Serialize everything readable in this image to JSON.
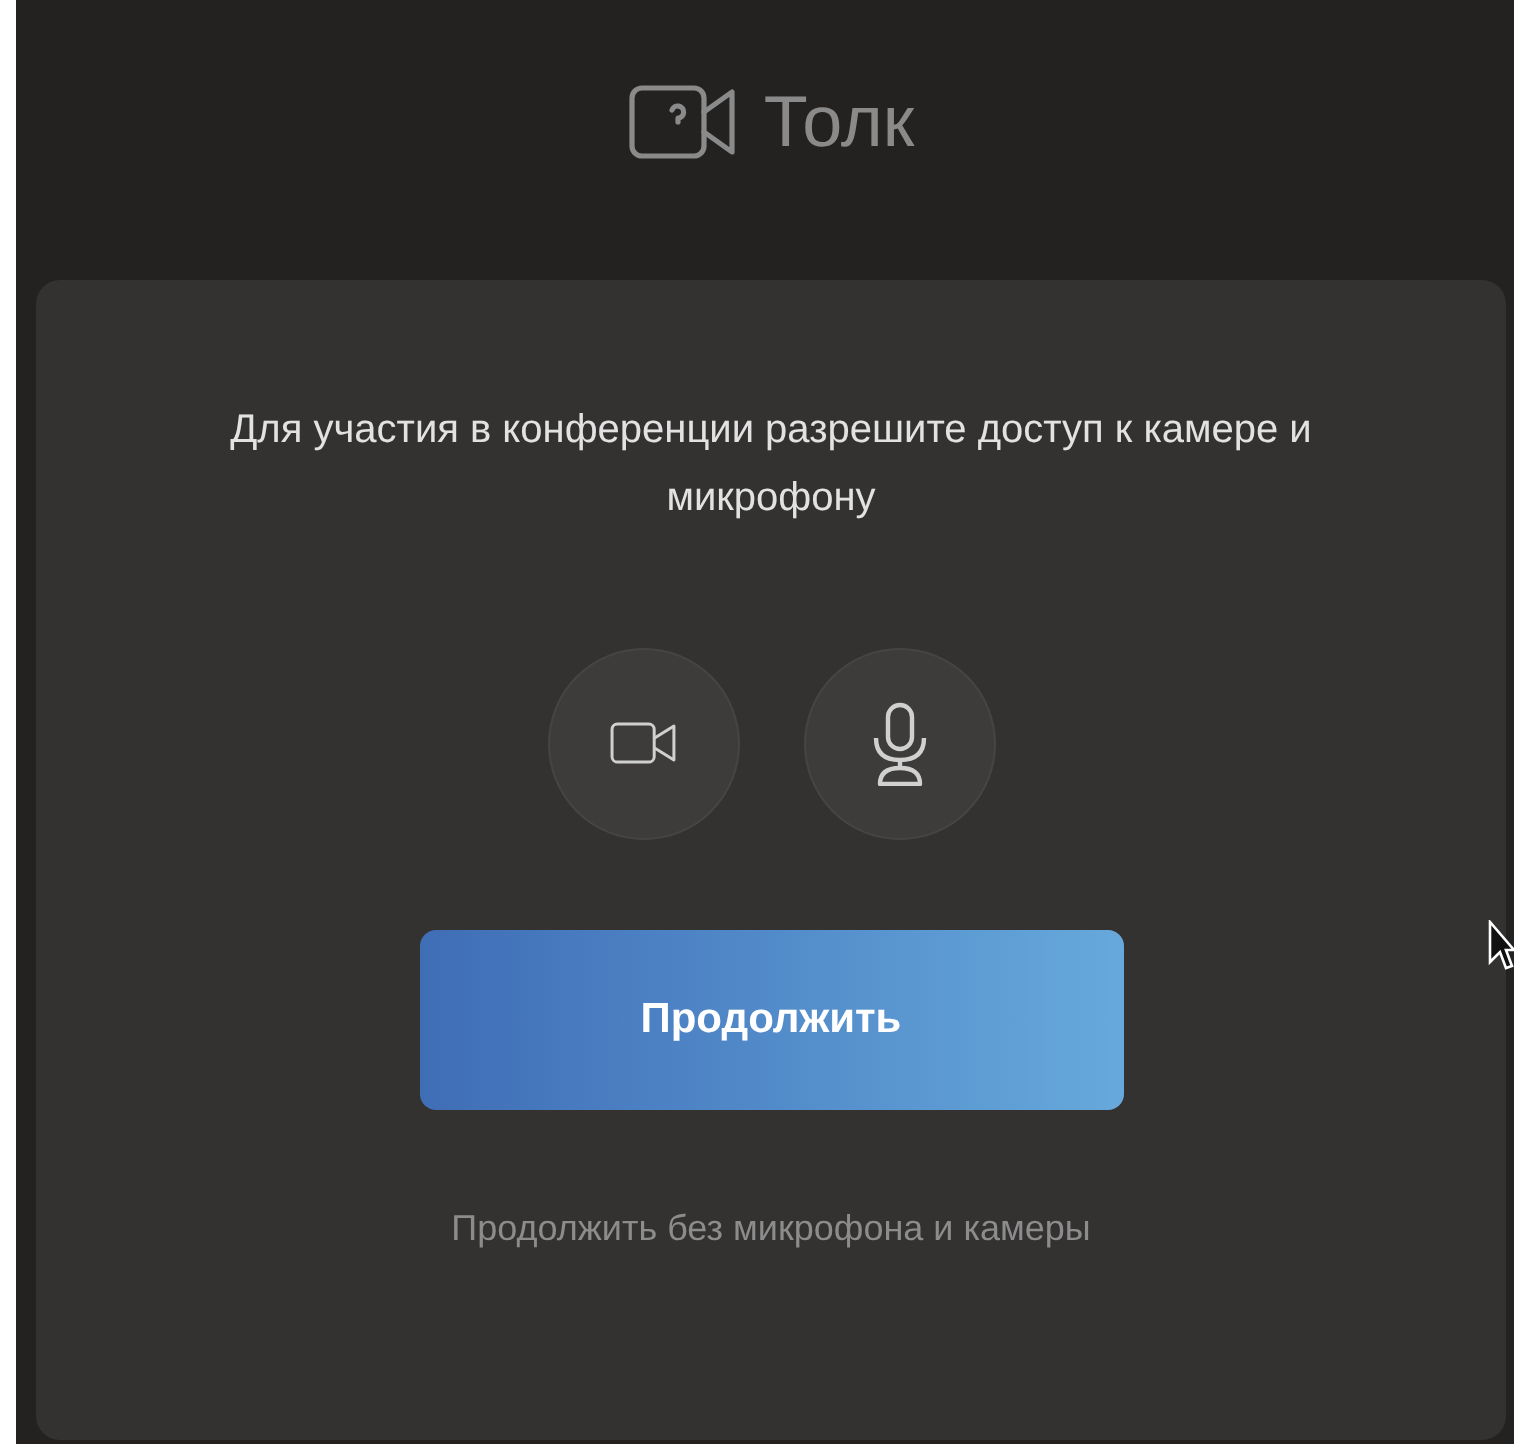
{
  "header": {
    "brand": "Толк"
  },
  "card": {
    "message": "Для участия в конференции разрешите доступ к камере и микрофону",
    "devices": [
      {
        "kind": "camera"
      },
      {
        "kind": "microphone"
      }
    ],
    "continue_button": "Продолжить",
    "skip_link": "Продолжить без микрофона и камеры"
  }
}
